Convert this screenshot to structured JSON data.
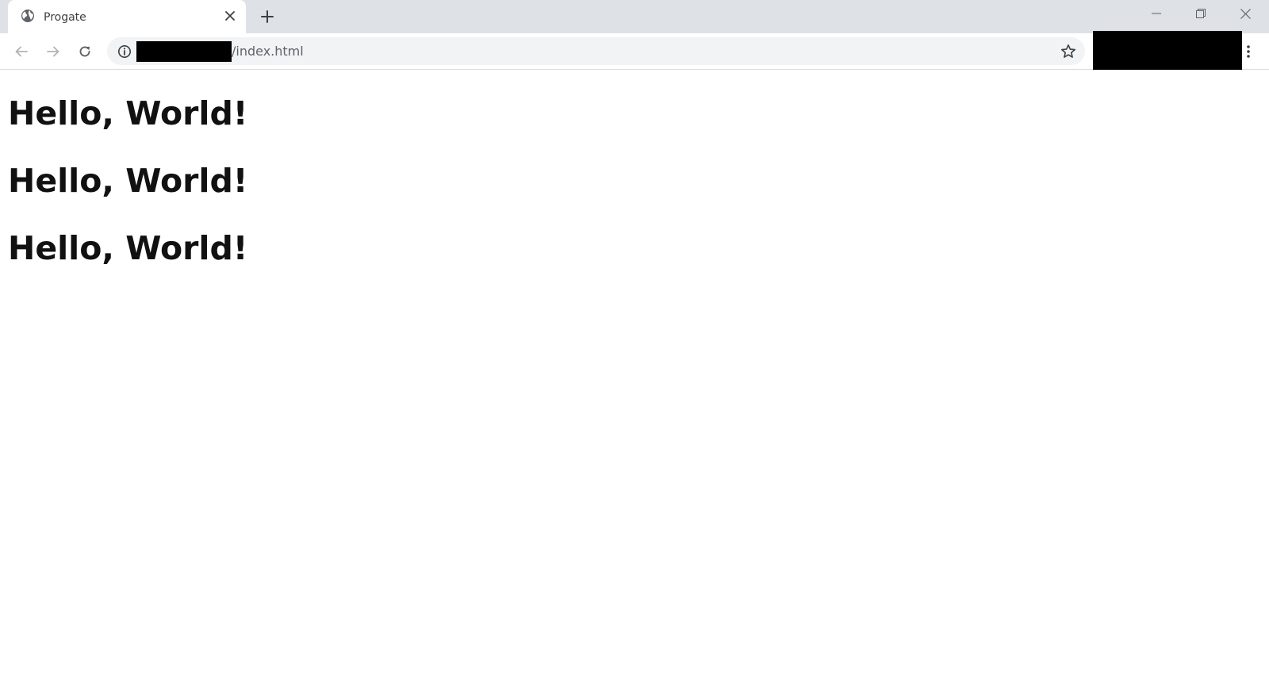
{
  "browser": {
    "tab": {
      "title": "Progate",
      "favicon": "globe-icon"
    },
    "address_bar": {
      "url_visible_suffix": "/index.html",
      "redacted": true
    },
    "icons": {
      "back": "arrow-left-icon",
      "forward": "arrow-right-icon",
      "reload": "reload-icon",
      "site_info": "info-icon",
      "bookmark": "star-icon",
      "menu": "kebab-menu-icon",
      "new_tab": "plus-icon",
      "tab_close": "close-icon",
      "window_minimize": "minimize-icon",
      "window_restore": "restore-icon",
      "window_close": "close-icon"
    },
    "colors": {
      "tabstrip": "#dee1e6",
      "omnibox": "#f1f3f4",
      "icon": "#5f6368",
      "text": "#111111"
    }
  },
  "page": {
    "headings": [
      "Hello, World!",
      "Hello, World!",
      "Hello, World!"
    ]
  }
}
